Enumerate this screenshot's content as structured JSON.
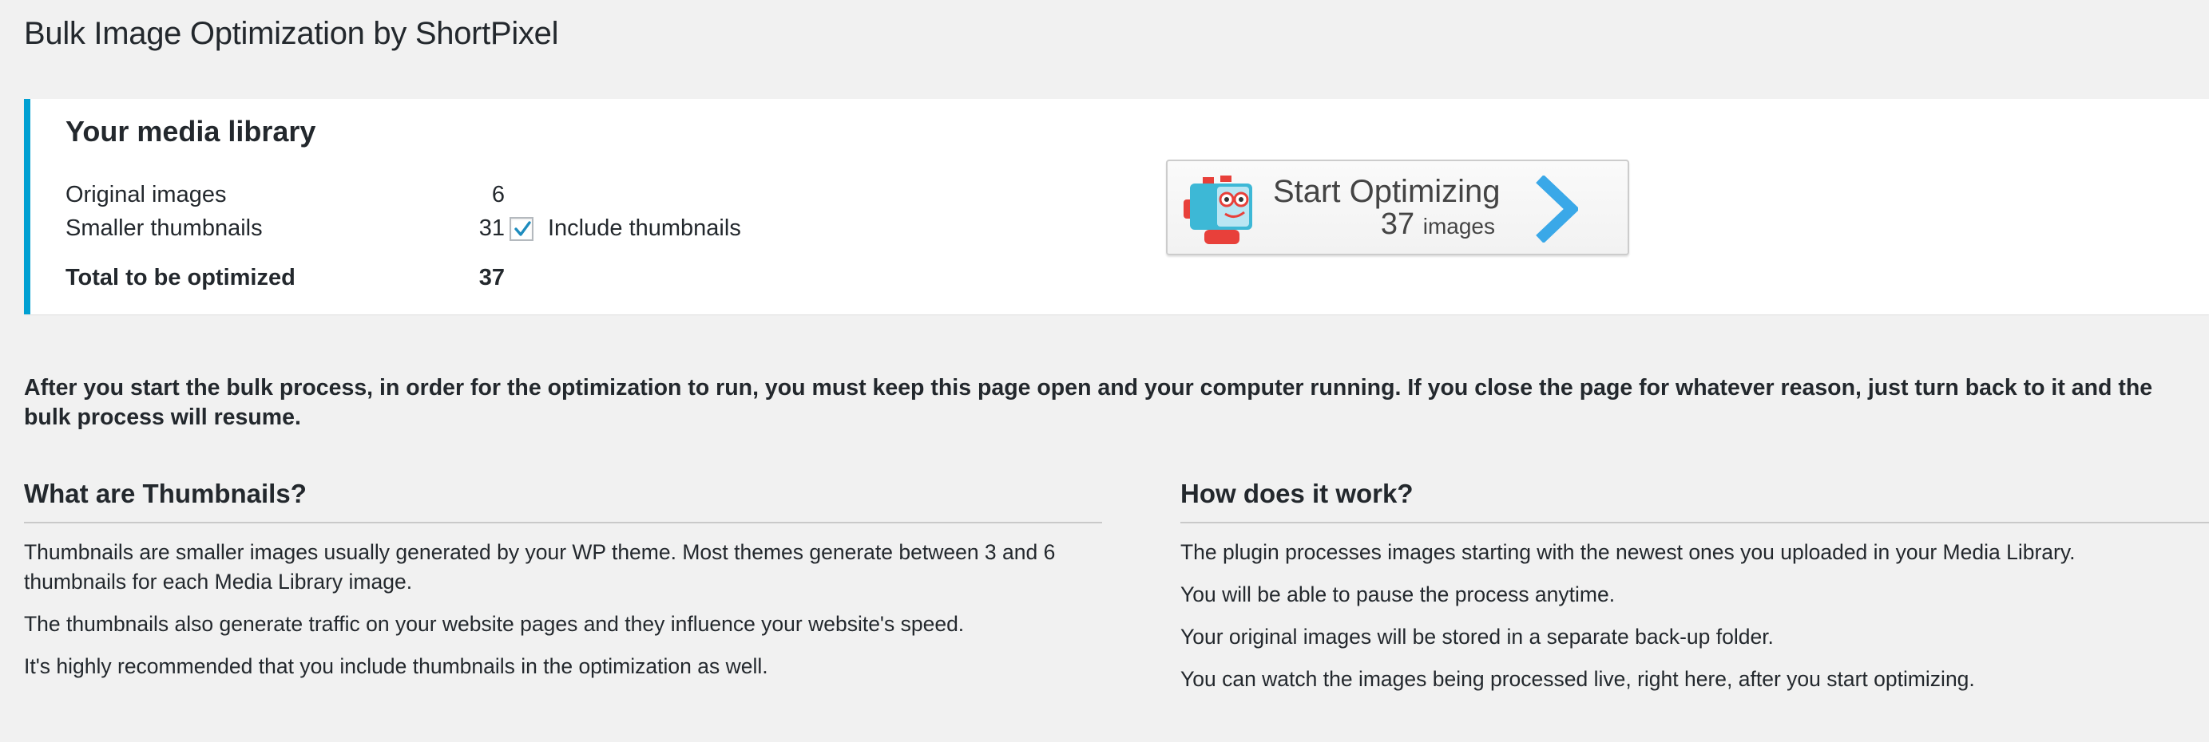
{
  "page": {
    "title": "Bulk Image Optimization by ShortPixel"
  },
  "library": {
    "title": "Your media library",
    "rows": [
      {
        "label": "Original images",
        "value": "6"
      },
      {
        "label": "Smaller thumbnails",
        "value": "31"
      },
      {
        "label": "Total to be optimized",
        "value": "37"
      }
    ],
    "include_thumbnails": {
      "label": "Include thumbnails",
      "checked": true
    }
  },
  "start_button": {
    "label": "Start Optimizing",
    "count": "37",
    "unit": "images",
    "icon": "robot-icon",
    "arrow_color": "#3aa8e8"
  },
  "notice": "After you start the bulk process, in order for the optimization to run, you must keep this page open and your computer running. If you close the page for whatever reason, just turn back to it and the bulk process will resume.",
  "thumbnails_section": {
    "title": "What are Thumbnails?",
    "paragraphs": [
      "Thumbnails are smaller images usually generated by your WP theme. Most themes generate between 3 and 6 thumbnails for each Media Library image.",
      "The thumbnails also generate traffic on your website pages and they influence your website's speed.",
      "It's highly recommended that you include thumbnails in the optimization as well."
    ]
  },
  "how_section": {
    "title": "How does it work?",
    "paragraphs": [
      "The plugin processes images starting with the newest ones you uploaded in your Media Library.",
      "You will be able to pause the process anytime.",
      "Your original images will be stored in a separate back-up folder.",
      "You can watch the images being processed live, right here, after you start optimizing."
    ]
  },
  "colors": {
    "accent_border": "#00a0d2",
    "background": "#f1f1f1"
  }
}
